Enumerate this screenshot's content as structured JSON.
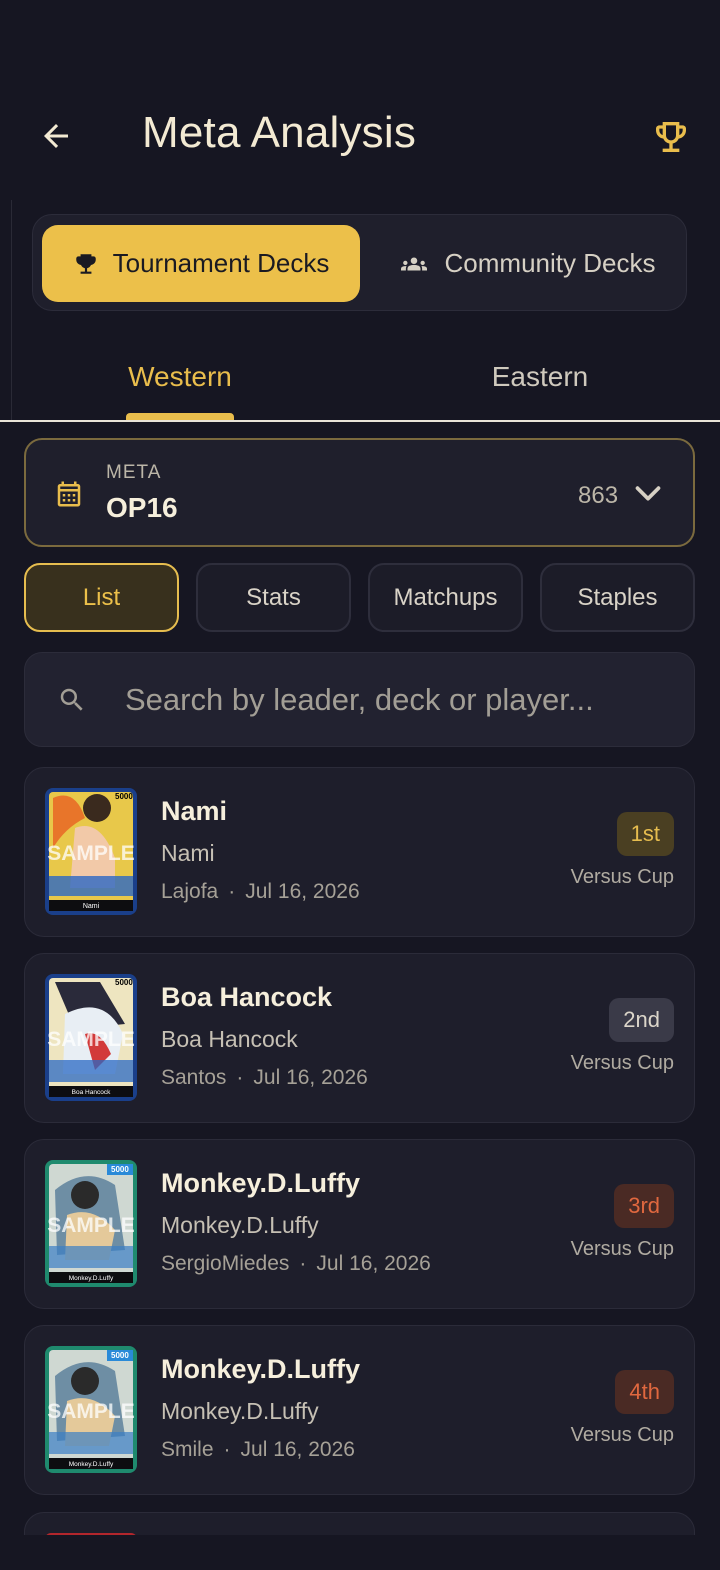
{
  "header": {
    "title": "Meta Analysis",
    "back_icon": "arrow-left-icon",
    "trophy_icon": "trophy-icon"
  },
  "source_toggle": {
    "active": "Tournament Decks",
    "inactive": "Community Decks"
  },
  "region_tabs": [
    "Western",
    "Eastern"
  ],
  "meta": {
    "caption": "META",
    "value": "OP16",
    "count": "863"
  },
  "view_tabs": [
    "List",
    "Stats",
    "Matchups",
    "Staples"
  ],
  "search": {
    "placeholder": "Search by leader, deck or player..."
  },
  "decks": [
    {
      "name": "Nami",
      "leader": "Nami",
      "player": "Lajofa",
      "date": "Jul 16, 2026",
      "place": "1st",
      "event": "Versus Cup"
    },
    {
      "name": "Boa Hancock",
      "leader": "Boa Hancock",
      "player": "Santos",
      "date": "Jul 16, 2026",
      "place": "2nd",
      "event": "Versus Cup"
    },
    {
      "name": "Monkey.D.Luffy",
      "leader": "Monkey.D.Luffy",
      "player": "SergioMiedes",
      "date": "Jul 16, 2026",
      "place": "3rd",
      "event": "Versus Cup"
    },
    {
      "name": "Monkey.D.Luffy",
      "leader": "Monkey.D.Luffy",
      "player": "Smile",
      "date": "Jul 16, 2026",
      "place": "4th",
      "event": "Versus Cup"
    }
  ],
  "card_art": [
    {
      "power": "5000",
      "watermark": "SAMPLE",
      "name": "Nami"
    },
    {
      "power": "5000",
      "watermark": "SAMPLE",
      "name": "Boa Hancock"
    },
    {
      "power": "5000",
      "watermark": "SAMPLE",
      "name": "Monkey.D.Luffy"
    },
    {
      "power": "5000",
      "watermark": "SAMPLE",
      "name": "Monkey.D.Luffy"
    }
  ],
  "colors": {
    "background": "#161622",
    "accent_gold": "#ecc04a",
    "badge_1st_bg": "#4a3f22",
    "badge_1st_fg": "#e6bd4f",
    "badge_2nd_bg": "#3a3a48",
    "badge_2nd_fg": "#dcd6ca",
    "badge_3rd_bg": "#4a2a24",
    "badge_3rd_fg": "#e0683f"
  }
}
